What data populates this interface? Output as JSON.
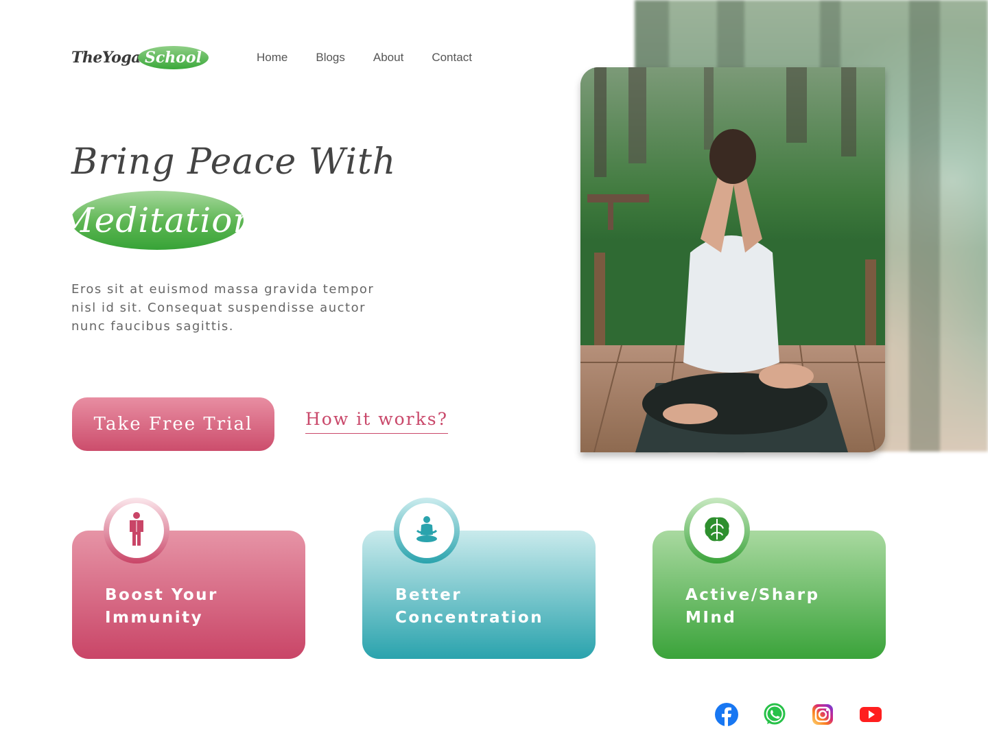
{
  "logo": {
    "part1": "TheYoga",
    "part2": "School"
  },
  "nav": {
    "items": [
      "Home",
      "Blogs",
      "About",
      "Contact"
    ]
  },
  "hero": {
    "title": "Bring Peace With",
    "highlight": "Meditation",
    "description": "Eros sit at euismod massa gravida tempor nisl id sit. Consequat suspendisse auctor nunc faucibus sagittis.",
    "cta_primary": "Take Free Trial",
    "cta_secondary": "How it works?"
  },
  "features": [
    {
      "title": "Boost Your Immunity",
      "icon": "human-body-icon",
      "color": "#c94567"
    },
    {
      "title": "Better Concentration",
      "icon": "meditation-icon",
      "color": "#2aa3ad"
    },
    {
      "title": "Active/Sharp MInd",
      "icon": "brain-icon",
      "color": "#3aa33a"
    }
  ],
  "social": [
    "facebook-icon",
    "whatsapp-icon",
    "instagram-icon",
    "youtube-icon"
  ],
  "colors": {
    "pink": "#c94567",
    "teal": "#2aa3ad",
    "green": "#3aa33a",
    "text": "#444444"
  }
}
